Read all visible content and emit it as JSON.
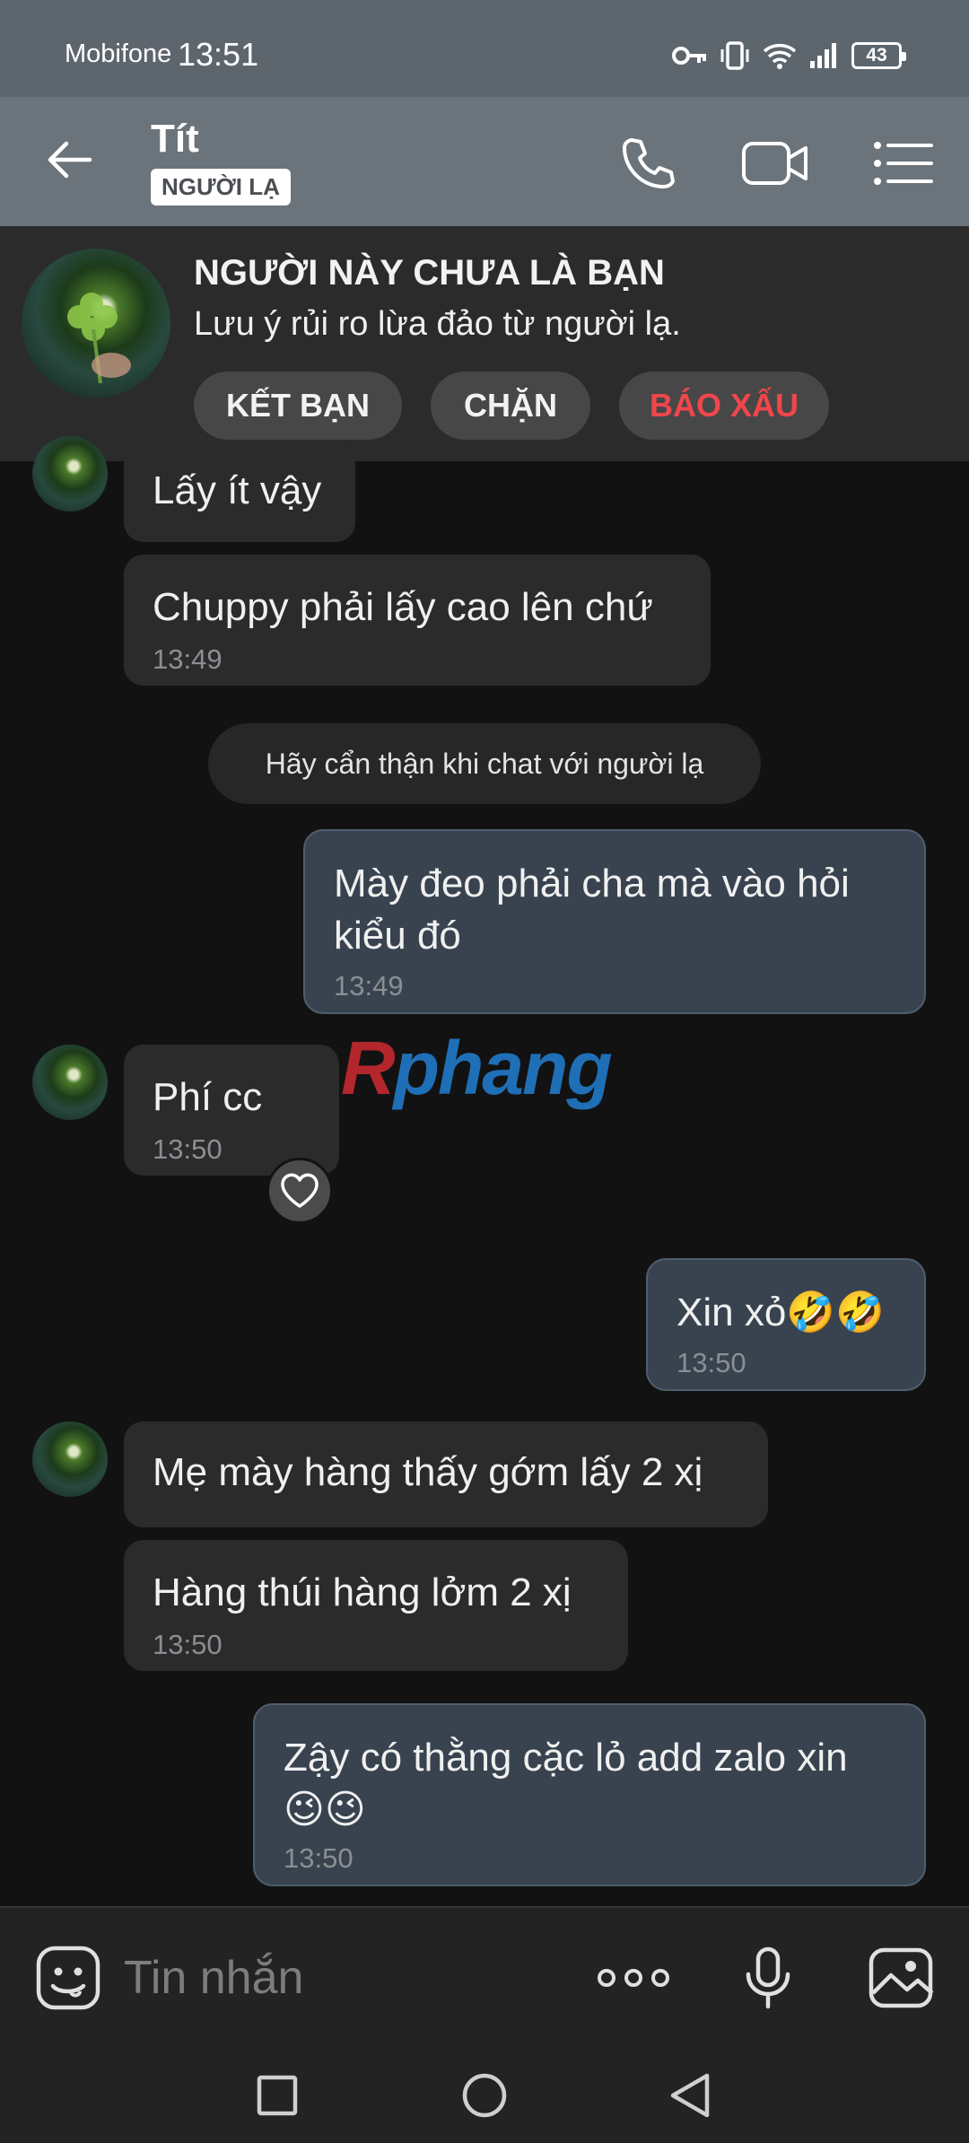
{
  "status_bar": {
    "carrier": "Mobifone",
    "time": "13:51",
    "battery": "43"
  },
  "header": {
    "name": "Tít",
    "tag": "NGƯỜI LẠ"
  },
  "banner": {
    "title": "NGƯỜI NÀY CHƯA LÀ BẠN",
    "subtitle": "Lưu ý rủi ro lừa đảo từ người lạ.",
    "add_friend": "KẾT BẠN",
    "block": "CHẶN",
    "report": "BÁO XẤU",
    "report_color": "#f0464c"
  },
  "messages": [
    {
      "text": "Lấy ít vậy",
      "time": ""
    },
    {
      "text": "Chuppy phải lấy cao lên chứ",
      "time": "13:49"
    },
    {
      "text": "Mày đeo phải cha mà vào hỏi kiểu đó",
      "time": "13:49"
    },
    {
      "text": "Phí cc",
      "time": "13:50"
    },
    {
      "text": "Xin xỏ🤣🤣",
      "time": "13:50"
    },
    {
      "text": "Mẹ mày hàng thấy gớm lấy 2 xị",
      "time": ""
    },
    {
      "text": "Hàng thúi hàng lởm 2 xị",
      "time": "13:50"
    },
    {
      "text": "Zậy có thằng cặc lỏ add zalo xin 😉😉",
      "time": "13:50"
    }
  ],
  "system_notice": "Hãy cẩn thận khi chat với người lạ",
  "watermark": {
    "part1": "R",
    "part2": "phang"
  },
  "composer": {
    "placeholder": "Tin nhắn"
  },
  "colors": {
    "header_bg": "#6b747b",
    "outgoing_bubble": "#38434f",
    "incoming_bubble": "#2b2b2b"
  }
}
